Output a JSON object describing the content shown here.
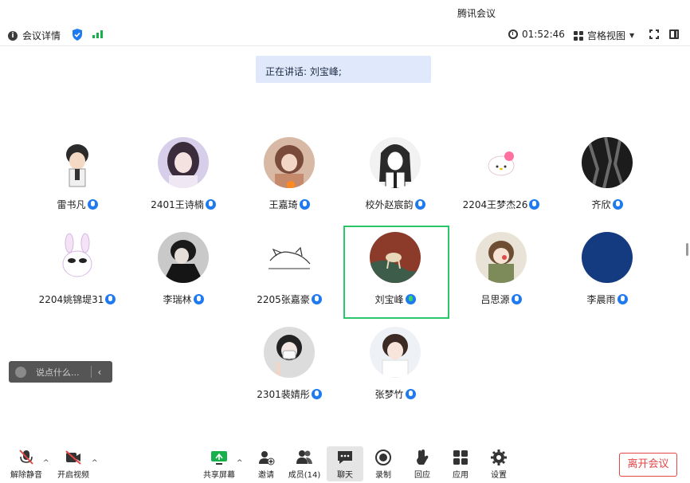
{
  "window": {
    "title": "腾讯会议"
  },
  "toolbar": {
    "meeting_info_label": "会议详情",
    "icons": [
      "info-icon",
      "shield-icon",
      "signal-icon",
      "clock-icon",
      "grid-view-icon",
      "fullscreen-icon",
      "sidebar-icon"
    ],
    "elapsed_time": "01:52:46",
    "view_mode": "宫格视图"
  },
  "speaking": {
    "text": "正在讲话: 刘宝峰;"
  },
  "participants": [
    {
      "name": "雷书凡",
      "mic": "on"
    },
    {
      "name": "2401王诗楠",
      "mic": "on"
    },
    {
      "name": "王嘉琦",
      "mic": "on"
    },
    {
      "name": "校外赵宸韵",
      "mic": "on"
    },
    {
      "name": "2204王梦杰26",
      "mic": "on"
    },
    {
      "name": "齐欣",
      "mic": "on"
    },
    {
      "name": "2204姚锦堤31",
      "mic": "on"
    },
    {
      "name": "李瑞林",
      "mic": "on"
    },
    {
      "name": "2205张嘉豪",
      "mic": "on"
    },
    {
      "name": "刘宝峰",
      "mic": "speaking"
    },
    {
      "name": "吕思源",
      "mic": "on"
    },
    {
      "name": "李晨雨",
      "mic": "on"
    },
    {
      "name": "2301裴婧彤",
      "mic": "on"
    },
    {
      "name": "张梦竹",
      "mic": "on"
    }
  ],
  "chat": {
    "placeholder": "说点什么..."
  },
  "bottom": {
    "unmute": "解除静音",
    "start_video": "开启视频",
    "share_screen": "共享屏幕",
    "invite": "邀请",
    "members": "成员(14)",
    "chat": "聊天",
    "record": "录制",
    "react": "回应",
    "apps": "应用",
    "settings": "设置",
    "leave": "离开会议"
  },
  "colors": {
    "accent": "#1f7af0",
    "speaking_border": "#29c66a",
    "leave": "#e54646",
    "banner": "#dfe9fb"
  }
}
